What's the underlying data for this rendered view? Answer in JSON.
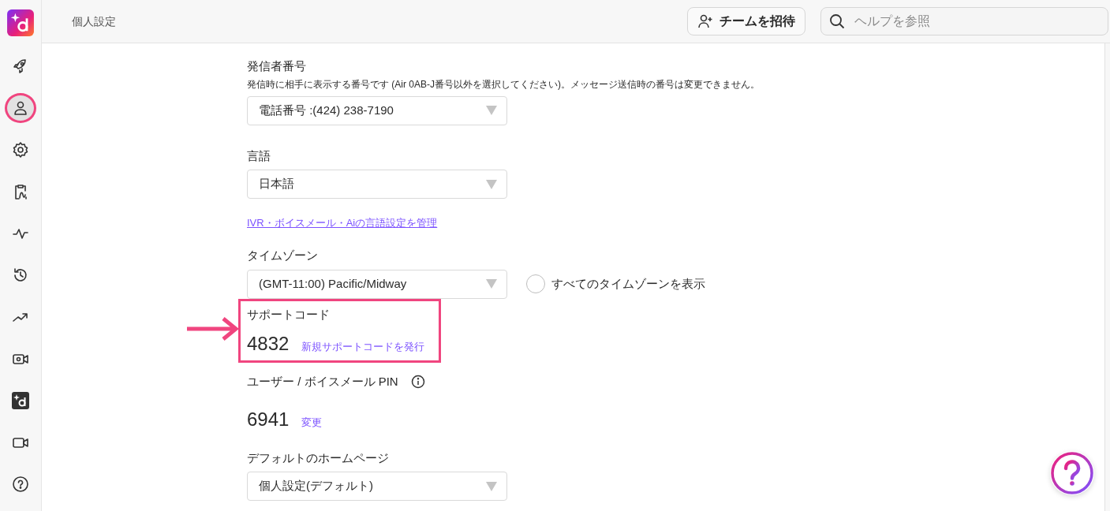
{
  "header": {
    "title": "個人設定",
    "invite_button": "チームを招待",
    "search": {
      "placeholder": "ヘルプを参照"
    }
  },
  "sidebar": {
    "items": [
      {
        "kind": "rocket",
        "selected": false
      },
      {
        "kind": "person",
        "selected": true
      },
      {
        "kind": "gear",
        "selected": false
      },
      {
        "kind": "clipboard",
        "selected": false
      },
      {
        "kind": "pulse",
        "selected": false
      },
      {
        "kind": "history",
        "selected": false
      },
      {
        "kind": "trend",
        "selected": false
      },
      {
        "kind": "camera",
        "selected": false
      },
      {
        "kind": "logo",
        "selected": false
      },
      {
        "kind": "video",
        "selected": false
      },
      {
        "kind": "help",
        "selected": false
      }
    ]
  },
  "sections": [
    {
      "kind": "select",
      "label": "発信者番号",
      "description": "発信時に相手に表示する番号です (Air 0AB-J番号以外を選択してください)。メッセージ送信時の番号は変更できません。",
      "value": "電話番号 :(424) 238-7190"
    },
    {
      "kind": "select",
      "label": "言語",
      "value": "日本語"
    },
    {
      "kind": "link",
      "text": "IVR・ボイスメール・Aiの言語設定を管理"
    },
    {
      "kind": "select",
      "label": "タイムゾーン",
      "value": "(GMT-11:00) Pacific/Midway",
      "option": {
        "label": "すべてのタイムゾーンを表示",
        "checked": false
      }
    },
    {
      "kind": "code",
      "label": "サポートコード",
      "value": "4832",
      "action": "新規サポートコードを発行",
      "highlighted": true
    },
    {
      "kind": "code",
      "label": "ユーザー / ボイスメール PIN",
      "info": true,
      "value": "6941",
      "action": "変更",
      "highlighted": false
    },
    {
      "kind": "select",
      "label": "デフォルトのホームページ",
      "value": "個人設定(デフォルト)"
    }
  ]
}
